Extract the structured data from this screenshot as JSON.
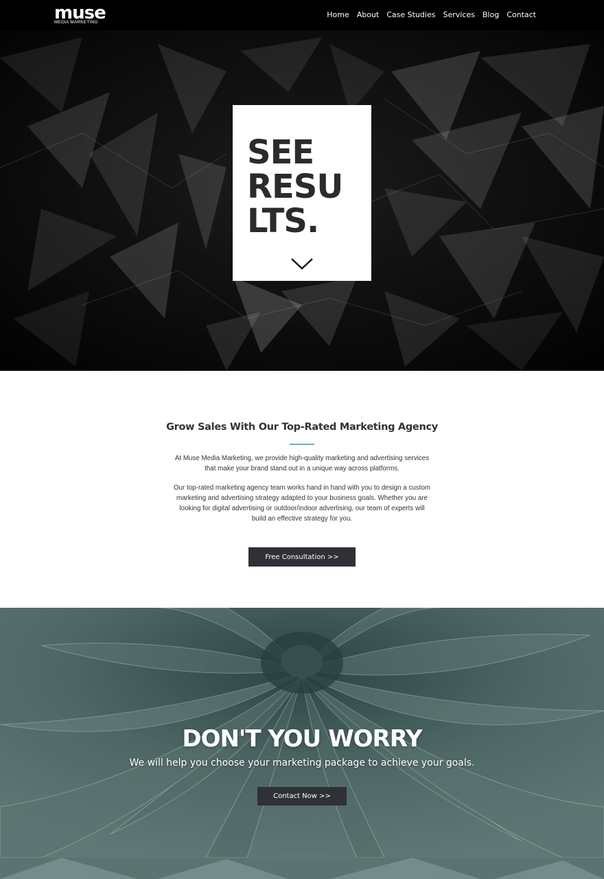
{
  "nav": {
    "logo_text": "muse",
    "logo_subtext": "MEDIA MARKETING",
    "links": [
      "Home",
      "About",
      "Case Studies",
      "Services",
      "Blog",
      "Contact"
    ]
  },
  "hero": {
    "lines": [
      "SEE",
      "RESU",
      "LTS."
    ],
    "scroll_icon": "chevron-down-icon"
  },
  "intro": {
    "title": "Grow Sales With Our Top-Rated Marketing Agency",
    "paragraph1": "At Muse Media Marketing, we provide high-quality marketing and advertising services that make your brand stand out in a unique way across platforms.",
    "paragraph2": "Our top-rated marketing agency team works hand in hand with you to design a custom marketing and advertising strategy adapted to your business goals. Whether you are looking for digital advertising or outdoor/indoor advertising, our team of experts will build an effective strategy for you.",
    "button_label": "Free Consultation >>",
    "accent_color": "#5ab5b7"
  },
  "banner": {
    "title": "DON'T YOU WORRY",
    "subtitle": "We will help you choose your marketing package to achieve your goals.",
    "button_label": "Contact Now >>"
  },
  "colors": {
    "nav_bg": "#000000",
    "button_bg": "#2f3137",
    "banner_tint": "#4c6664"
  }
}
